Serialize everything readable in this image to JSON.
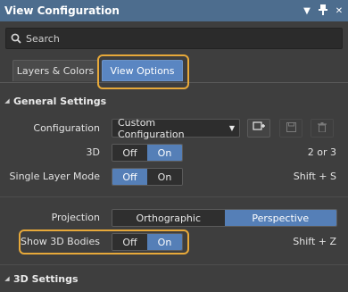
{
  "window": {
    "title": "View Configuration",
    "icons": [
      "pin-icon",
      "float-icon",
      "close-icon"
    ]
  },
  "search": {
    "placeholder": "Search"
  },
  "tabs": [
    {
      "label": "Layers & Colors",
      "active": false
    },
    {
      "label": "View Options",
      "active": true
    }
  ],
  "general_settings": {
    "title": "General Settings",
    "configuration": {
      "label": "Configuration",
      "value": "Custom Configuration",
      "icons": [
        "add-icon",
        "save-icon",
        "delete-icon"
      ]
    },
    "mode_3d": {
      "label": "3D",
      "off": "Off",
      "on": "On",
      "selected": "On",
      "shortcut": "2 or 3"
    },
    "single_layer": {
      "label": "Single Layer Mode",
      "off": "Off",
      "on": "On",
      "selected": "Off",
      "shortcut": "Shift + S"
    },
    "projection": {
      "label": "Projection",
      "option_a": "Orthographic",
      "option_b": "Perspective",
      "selected": "Perspective"
    },
    "show_3d_bodies": {
      "label": "Show 3D Bodies",
      "off": "Off",
      "on": "On",
      "selected": "On",
      "shortcut": "Shift + Z"
    }
  },
  "settings_3d": {
    "title": "3D Settings"
  },
  "colors": {
    "titlebar": "#4d6d8e",
    "panel": "#3e3e3e",
    "selected": "#557fb7",
    "highlight": "#e7a93a"
  }
}
